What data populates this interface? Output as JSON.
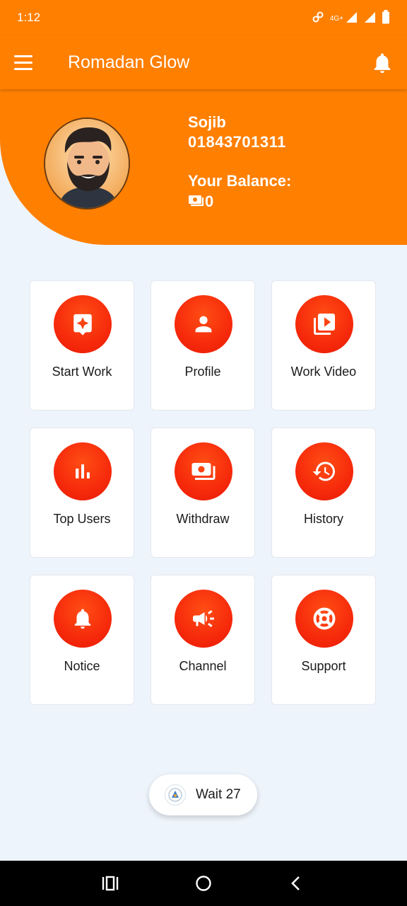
{
  "status_bar": {
    "time": "1:12",
    "network": "4G+",
    "icons": [
      "link-icon",
      "signal-icon",
      "signal-icon",
      "battery-icon"
    ]
  },
  "app_bar": {
    "title": "Romadan Glow",
    "menu_icon": "hamburger-menu-icon",
    "bell_icon": "notification-bell-icon"
  },
  "profile": {
    "name": "Sojib",
    "phone": "01843701311",
    "balance_label": "Your Balance:",
    "balance_value": "0",
    "balance_icon": "money-icon"
  },
  "menu": [
    {
      "label": "Start Work",
      "icon": "start-work-icon"
    },
    {
      "label": "Profile",
      "icon": "person-icon"
    },
    {
      "label": "Work Video",
      "icon": "video-library-icon"
    },
    {
      "label": "Top Users",
      "icon": "bar-chart-icon"
    },
    {
      "label": "Withdraw",
      "icon": "money-icon"
    },
    {
      "label": "History",
      "icon": "history-icon"
    },
    {
      "label": "Notice",
      "icon": "bell-icon"
    },
    {
      "label": "Channel",
      "icon": "megaphone-icon"
    },
    {
      "label": "Support",
      "icon": "lifebuoy-icon"
    }
  ],
  "toast": {
    "text": "Wait 27",
    "icon": "app-logo-icon"
  },
  "nav_bar": {
    "icons": [
      "recent-apps-icon",
      "home-icon",
      "back-icon"
    ]
  },
  "colors": {
    "primary": "#ff7f00",
    "icon_circle": "#f62a0b",
    "background": "#eef4fb"
  }
}
